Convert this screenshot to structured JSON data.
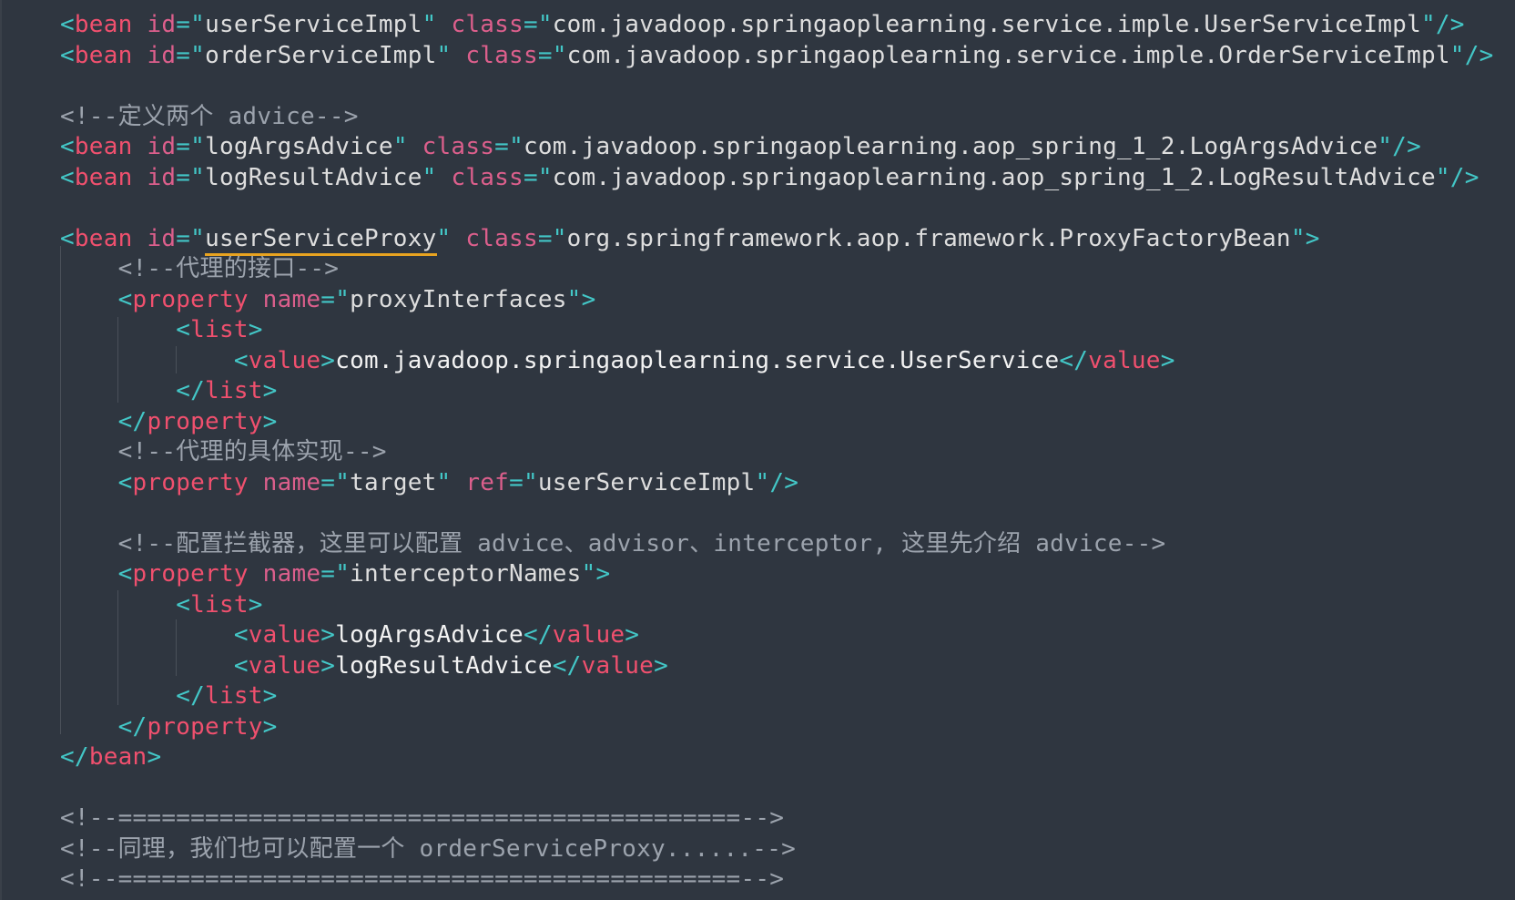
{
  "editor": {
    "colors": {
      "background": "#2f3640",
      "punctuation": "#43c7c7",
      "tag": "#f0506e",
      "attribute": "#dc5f8c",
      "string": "#dedede",
      "text": "#f2f2f2",
      "comment": "#9ca3ad",
      "highlight_underline": "#e8a320"
    },
    "lines": [
      {
        "tokens": [
          {
            "t": "<",
            "c": "punct"
          },
          {
            "t": "bean",
            "c": "tag"
          },
          {
            "t": " "
          },
          {
            "t": "id",
            "c": "attr"
          },
          {
            "t": "=",
            "c": "punct"
          },
          {
            "t": "\"",
            "c": "punct"
          },
          {
            "t": "userServiceImpl",
            "c": "str"
          },
          {
            "t": "\"",
            "c": "punct"
          },
          {
            "t": " "
          },
          {
            "t": "class",
            "c": "attr"
          },
          {
            "t": "=",
            "c": "punct"
          },
          {
            "t": "\"",
            "c": "punct"
          },
          {
            "t": "com.javadoop.springaoplearning.service.imple.UserServiceImpl",
            "c": "str"
          },
          {
            "t": "\"",
            "c": "punct"
          },
          {
            "t": "/>",
            "c": "punct"
          }
        ]
      },
      {
        "tokens": [
          {
            "t": "<",
            "c": "punct"
          },
          {
            "t": "bean",
            "c": "tag"
          },
          {
            "t": " "
          },
          {
            "t": "id",
            "c": "attr"
          },
          {
            "t": "=",
            "c": "punct"
          },
          {
            "t": "\"",
            "c": "punct"
          },
          {
            "t": "orderServiceImpl",
            "c": "str"
          },
          {
            "t": "\"",
            "c": "punct"
          },
          {
            "t": " "
          },
          {
            "t": "class",
            "c": "attr"
          },
          {
            "t": "=",
            "c": "punct"
          },
          {
            "t": "\"",
            "c": "punct"
          },
          {
            "t": "com.javadoop.springaoplearning.service.imple.OrderServiceImpl",
            "c": "str"
          },
          {
            "t": "\"",
            "c": "punct"
          },
          {
            "t": "/>",
            "c": "punct"
          }
        ]
      },
      {
        "tokens": []
      },
      {
        "tokens": [
          {
            "t": "<!--定义两个 advice-->",
            "c": "comment"
          }
        ]
      },
      {
        "tokens": [
          {
            "t": "<",
            "c": "punct"
          },
          {
            "t": "bean",
            "c": "tag"
          },
          {
            "t": " "
          },
          {
            "t": "id",
            "c": "attr"
          },
          {
            "t": "=",
            "c": "punct"
          },
          {
            "t": "\"",
            "c": "punct"
          },
          {
            "t": "logArgsAdvice",
            "c": "str"
          },
          {
            "t": "\"",
            "c": "punct"
          },
          {
            "t": " "
          },
          {
            "t": "class",
            "c": "attr"
          },
          {
            "t": "=",
            "c": "punct"
          },
          {
            "t": "\"",
            "c": "punct"
          },
          {
            "t": "com.javadoop.springaoplearning.aop_spring_1_2.LogArgsAdvice",
            "c": "str"
          },
          {
            "t": "\"",
            "c": "punct"
          },
          {
            "t": "/>",
            "c": "punct"
          }
        ]
      },
      {
        "tokens": [
          {
            "t": "<",
            "c": "punct"
          },
          {
            "t": "bean",
            "c": "tag"
          },
          {
            "t": " "
          },
          {
            "t": "id",
            "c": "attr"
          },
          {
            "t": "=",
            "c": "punct"
          },
          {
            "t": "\"",
            "c": "punct"
          },
          {
            "t": "logResultAdvice",
            "c": "str"
          },
          {
            "t": "\"",
            "c": "punct"
          },
          {
            "t": " "
          },
          {
            "t": "class",
            "c": "attr"
          },
          {
            "t": "=",
            "c": "punct"
          },
          {
            "t": "\"",
            "c": "punct"
          },
          {
            "t": "com.javadoop.springaoplearning.aop_spring_1_2.LogResultAdvice",
            "c": "str"
          },
          {
            "t": "\"",
            "c": "punct"
          },
          {
            "t": "/>",
            "c": "punct"
          }
        ]
      },
      {
        "tokens": []
      },
      {
        "tokens": [
          {
            "t": "<",
            "c": "punct"
          },
          {
            "t": "bean",
            "c": "tag"
          },
          {
            "t": " "
          },
          {
            "t": "id",
            "c": "attr"
          },
          {
            "t": "=",
            "c": "punct"
          },
          {
            "t": "\"",
            "c": "punct"
          },
          {
            "t": "userServiceProxy",
            "c": "str",
            "hl": true
          },
          {
            "t": "\"",
            "c": "punct"
          },
          {
            "t": " "
          },
          {
            "t": "class",
            "c": "attr"
          },
          {
            "t": "=",
            "c": "punct"
          },
          {
            "t": "\"",
            "c": "punct"
          },
          {
            "t": "org.springframework.aop.framework.ProxyFactoryBean",
            "c": "str"
          },
          {
            "t": "\"",
            "c": "punct"
          },
          {
            "t": ">",
            "c": "punct"
          }
        ]
      },
      {
        "tokens": [
          {
            "t": "    "
          },
          {
            "t": "<!--代理的接口-->",
            "c": "comment"
          }
        ]
      },
      {
        "tokens": [
          {
            "t": "    "
          },
          {
            "t": "<",
            "c": "punct"
          },
          {
            "t": "property",
            "c": "tag"
          },
          {
            "t": " "
          },
          {
            "t": "name",
            "c": "attr"
          },
          {
            "t": "=",
            "c": "punct"
          },
          {
            "t": "\"",
            "c": "punct"
          },
          {
            "t": "proxyInterfaces",
            "c": "str"
          },
          {
            "t": "\"",
            "c": "punct"
          },
          {
            "t": ">",
            "c": "punct"
          }
        ]
      },
      {
        "tokens": [
          {
            "t": "        "
          },
          {
            "t": "<",
            "c": "punct"
          },
          {
            "t": "list",
            "c": "tag"
          },
          {
            "t": ">",
            "c": "punct"
          }
        ]
      },
      {
        "tokens": [
          {
            "t": "            "
          },
          {
            "t": "<",
            "c": "punct"
          },
          {
            "t": "value",
            "c": "tag"
          },
          {
            "t": ">",
            "c": "punct"
          },
          {
            "t": "com.javadoop.springaoplearning.service.UserService",
            "c": "text"
          },
          {
            "t": "</",
            "c": "punct"
          },
          {
            "t": "value",
            "c": "tag"
          },
          {
            "t": ">",
            "c": "punct"
          }
        ]
      },
      {
        "tokens": [
          {
            "t": "        "
          },
          {
            "t": "</",
            "c": "punct"
          },
          {
            "t": "list",
            "c": "tag"
          },
          {
            "t": ">",
            "c": "punct"
          }
        ]
      },
      {
        "tokens": [
          {
            "t": "    "
          },
          {
            "t": "</",
            "c": "punct"
          },
          {
            "t": "property",
            "c": "tag"
          },
          {
            "t": ">",
            "c": "punct"
          }
        ]
      },
      {
        "tokens": [
          {
            "t": "    "
          },
          {
            "t": "<!--代理的具体实现-->",
            "c": "comment"
          }
        ]
      },
      {
        "tokens": [
          {
            "t": "    "
          },
          {
            "t": "<",
            "c": "punct"
          },
          {
            "t": "property",
            "c": "tag"
          },
          {
            "t": " "
          },
          {
            "t": "name",
            "c": "attr"
          },
          {
            "t": "=",
            "c": "punct"
          },
          {
            "t": "\"",
            "c": "punct"
          },
          {
            "t": "target",
            "c": "str"
          },
          {
            "t": "\"",
            "c": "punct"
          },
          {
            "t": " "
          },
          {
            "t": "ref",
            "c": "attr"
          },
          {
            "t": "=",
            "c": "punct"
          },
          {
            "t": "\"",
            "c": "punct"
          },
          {
            "t": "userServiceImpl",
            "c": "str"
          },
          {
            "t": "\"",
            "c": "punct"
          },
          {
            "t": "/>",
            "c": "punct"
          }
        ]
      },
      {
        "tokens": []
      },
      {
        "tokens": [
          {
            "t": "    "
          },
          {
            "t": "<!--配置拦截器，这里可以配置 advice、advisor、interceptor, 这里先介绍 advice-->",
            "c": "comment"
          }
        ]
      },
      {
        "tokens": [
          {
            "t": "    "
          },
          {
            "t": "<",
            "c": "punct"
          },
          {
            "t": "property",
            "c": "tag"
          },
          {
            "t": " "
          },
          {
            "t": "name",
            "c": "attr"
          },
          {
            "t": "=",
            "c": "punct"
          },
          {
            "t": "\"",
            "c": "punct"
          },
          {
            "t": "interceptorNames",
            "c": "str"
          },
          {
            "t": "\"",
            "c": "punct"
          },
          {
            "t": ">",
            "c": "punct"
          }
        ]
      },
      {
        "tokens": [
          {
            "t": "        "
          },
          {
            "t": "<",
            "c": "punct"
          },
          {
            "t": "list",
            "c": "tag"
          },
          {
            "t": ">",
            "c": "punct"
          }
        ]
      },
      {
        "tokens": [
          {
            "t": "            "
          },
          {
            "t": "<",
            "c": "punct"
          },
          {
            "t": "value",
            "c": "tag"
          },
          {
            "t": ">",
            "c": "punct"
          },
          {
            "t": "logArgsAdvice",
            "c": "text"
          },
          {
            "t": "</",
            "c": "punct"
          },
          {
            "t": "value",
            "c": "tag"
          },
          {
            "t": ">",
            "c": "punct"
          }
        ]
      },
      {
        "tokens": [
          {
            "t": "            "
          },
          {
            "t": "<",
            "c": "punct"
          },
          {
            "t": "value",
            "c": "tag"
          },
          {
            "t": ">",
            "c": "punct"
          },
          {
            "t": "logResultAdvice",
            "c": "text"
          },
          {
            "t": "</",
            "c": "punct"
          },
          {
            "t": "value",
            "c": "tag"
          },
          {
            "t": ">",
            "c": "punct"
          }
        ]
      },
      {
        "tokens": [
          {
            "t": "        "
          },
          {
            "t": "</",
            "c": "punct"
          },
          {
            "t": "list",
            "c": "tag"
          },
          {
            "t": ">",
            "c": "punct"
          }
        ]
      },
      {
        "tokens": [
          {
            "t": "    "
          },
          {
            "t": "</",
            "c": "punct"
          },
          {
            "t": "property",
            "c": "tag"
          },
          {
            "t": ">",
            "c": "punct"
          }
        ]
      },
      {
        "tokens": [
          {
            "t": "</",
            "c": "punct"
          },
          {
            "t": "bean",
            "c": "tag"
          },
          {
            "t": ">",
            "c": "punct"
          }
        ]
      },
      {
        "tokens": []
      },
      {
        "tokens": [
          {
            "t": "<!--===========================================-->",
            "c": "comment"
          }
        ]
      },
      {
        "tokens": [
          {
            "t": "<!--同理，我们也可以配置一个 orderServiceProxy......-->",
            "c": "comment"
          }
        ]
      },
      {
        "tokens": [
          {
            "t": "<!--===========================================-->",
            "c": "comment"
          }
        ]
      }
    ]
  }
}
